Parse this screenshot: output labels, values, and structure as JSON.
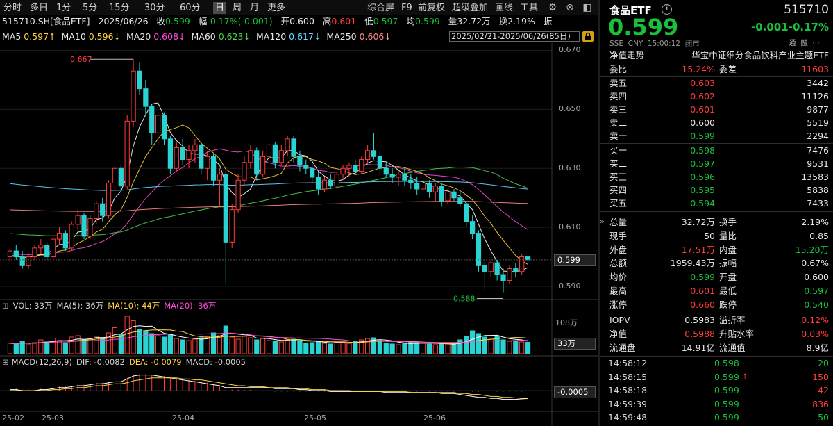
{
  "toolbar": {
    "periods": [
      "分时",
      "多日",
      "1分",
      "5分",
      "15分",
      "30分",
      "60分",
      "日",
      "周",
      "月",
      "更多"
    ],
    "active_period": "日",
    "tools": [
      "综合屏",
      "F9",
      "前复权",
      "超级叠加",
      "画线",
      "工具"
    ],
    "icons": [
      "gear-icon",
      "close-icon",
      "collapse-icon"
    ]
  },
  "info": {
    "code": "515710.SH[食品ETF]",
    "date": "2025/06/26",
    "close_label": "收",
    "close_val": "0.599",
    "chg_label": "幅",
    "chg_val": "-0.17%(-0.001)",
    "open_label": "开",
    "open_val": "0.600",
    "high_label": "高",
    "high_val": "0.601",
    "low_label": "低",
    "low_val": "0.597",
    "avg_label": "均",
    "avg_val": "0.599",
    "vol_label": "量",
    "vol_val": "32.72万",
    "turn_label": "换",
    "turn_val": "2.19%",
    "amp_label": "振"
  },
  "ma": {
    "items": [
      {
        "label": "MA5",
        "val": "0.597↑",
        "color": "#ffd23c"
      },
      {
        "label": "MA10",
        "val": "0.596↓",
        "color": "#ffd23c"
      },
      {
        "label": "MA20",
        "val": "0.608↓",
        "color": "#ff4ad8"
      },
      {
        "label": "MA60",
        "val": "0.623↓",
        "color": "#4fd34f"
      },
      {
        "label": "MA120",
        "val": "0.617↓",
        "color": "#6ad8ff"
      },
      {
        "label": "MA250",
        "val": "0.606↓",
        "color": "#ff8a8a"
      }
    ],
    "range": "2025/02/21-2025/06/26(85日)"
  },
  "price_axis": [
    "0.670",
    "0.650",
    "0.630",
    "0.610",
    "0.590"
  ],
  "current_price_tag": "0.599",
  "annotations": {
    "high": "0.667",
    "low": "0.588"
  },
  "vol_panel": {
    "header": "VOL: 33万 MA(5): 36万 MA(10): 44万 MA(20): 36万",
    "items": [
      {
        "text": "VOL: 33万",
        "color": "#d0d0d0"
      },
      {
        "text": "MA(5): 36万",
        "color": "#d0d0d0"
      },
      {
        "text": "MA(10): 44万",
        "color": "#ffd23c"
      },
      {
        "text": "MA(20): 36万",
        "color": "#ff4ad8"
      }
    ],
    "axis_top": "108万",
    "tag": "33万"
  },
  "macd_panel": {
    "items": [
      {
        "text": "MACD(12,26,9)",
        "color": "#d0d0d0"
      },
      {
        "text": "DIF: -0.0082",
        "color": "#d0d0d0"
      },
      {
        "text": "DEA: -0.0079",
        "color": "#ffd23c"
      },
      {
        "text": "MACD: -0.0005",
        "color": "#d0d0d0"
      }
    ],
    "tag": "-0.0005"
  },
  "x_axis": [
    "25-02",
    "25-03",
    "25-04",
    "25-05",
    "25-06"
  ],
  "right": {
    "name": "食品ETF",
    "info_icon": "info-icon",
    "code": "515710",
    "price": "0.599",
    "chg": "-0.001",
    "pct": "-0.17%",
    "sub": "SSE  CNY  15:00:12  闭市",
    "sub_icons": [
      "通",
      "融",
      "⋯"
    ],
    "nav_label": "净值走势",
    "fund_name": "华宝中证细分食品饮料产业主题ETF",
    "ratio": {
      "l1": "委比",
      "v1": "15.24%",
      "l2": "委差",
      "v2": "11603"
    },
    "asks": [
      {
        "label": "卖五",
        "price": "0.603",
        "vol": "3442",
        "c": "up"
      },
      {
        "label": "卖四",
        "price": "0.602",
        "vol": "11126",
        "c": "up"
      },
      {
        "label": "卖三",
        "price": "0.601",
        "vol": "9877",
        "c": "up"
      },
      {
        "label": "卖二",
        "price": "0.600",
        "vol": "5519",
        "c": "wh"
      },
      {
        "label": "卖一",
        "price": "0.599",
        "vol": "2294",
        "c": "dn"
      }
    ],
    "bids": [
      {
        "label": "买一",
        "price": "0.598",
        "vol": "7476",
        "c": "dn"
      },
      {
        "label": "买二",
        "price": "0.597",
        "vol": "9531",
        "c": "dn"
      },
      {
        "label": "买三",
        "price": "0.596",
        "vol": "13583",
        "c": "dn"
      },
      {
        "label": "买四",
        "price": "0.595",
        "vol": "5838",
        "c": "dn"
      },
      {
        "label": "买五",
        "price": "0.594",
        "vol": "7433",
        "c": "dn"
      }
    ],
    "stats": [
      {
        "l1": "总量",
        "v1": "32.72万",
        "c1": "wh",
        "l2": "换手",
        "v2": "2.19%",
        "c2": "wh"
      },
      {
        "l1": "现手",
        "v1": "50",
        "c1": "wh",
        "l2": "量比",
        "v2": "0.85",
        "c2": "wh"
      },
      {
        "l1": "外盘",
        "v1": "17.51万",
        "c1": "up",
        "l2": "内盘",
        "v2": "15.20万",
        "c2": "dn"
      },
      {
        "l1": "总额",
        "v1": "1959.43万",
        "c1": "wh",
        "l2": "振幅",
        "v2": "0.67%",
        "c2": "wh"
      },
      {
        "l1": "均价",
        "v1": "0.599",
        "c1": "dn",
        "l2": "开盘",
        "v2": "0.600",
        "c2": "wh"
      },
      {
        "l1": "最高",
        "v1": "0.601",
        "c1": "up",
        "l2": "最低",
        "v2": "0.597",
        "c2": "dn"
      },
      {
        "l1": "涨停",
        "v1": "0.660",
        "c1": "up",
        "l2": "跌停",
        "v2": "0.540",
        "c2": "dn"
      }
    ],
    "fund": [
      {
        "l1": "IOPV",
        "v1": "0.5983",
        "c1": "wh",
        "l2": "溢折率",
        "v2": "0.12%",
        "c2": "up"
      },
      {
        "l1": "净值",
        "v1": "0.5988",
        "c1": "up",
        "l2": "升贴水率",
        "v2": "0.03%",
        "c2": "up"
      },
      {
        "l1": "流通盘",
        "v1": "14.91亿",
        "c1": "wh",
        "l2": "流通值",
        "v2": "8.9亿",
        "c2": "wh"
      }
    ],
    "ticks": [
      {
        "time": "14:58:12",
        "price": "0.598",
        "arrow": "",
        "vol": "20",
        "pc": "dn",
        "vc": "dn"
      },
      {
        "time": "14:58:15",
        "price": "0.599",
        "arrow": "↑",
        "vol": "150",
        "pc": "dn",
        "vc": "up"
      },
      {
        "time": "14:58:18",
        "price": "0.599",
        "arrow": "",
        "vol": "42",
        "pc": "dn",
        "vc": "up"
      },
      {
        "time": "14:59:39",
        "price": "0.599",
        "arrow": "",
        "vol": "836",
        "pc": "dn",
        "vc": "up"
      },
      {
        "time": "14:59:48",
        "price": "0.599",
        "arrow": "",
        "vol": "50",
        "pc": "dn",
        "vc": "dn"
      }
    ]
  },
  "chart_data": {
    "type": "candlestick",
    "ylim": [
      0.586,
      0.672
    ],
    "ohlc": [
      [
        0.6,
        0.603,
        0.598,
        0.602
      ],
      [
        0.602,
        0.604,
        0.599,
        0.6
      ],
      [
        0.6,
        0.602,
        0.596,
        0.597
      ],
      [
        0.597,
        0.601,
        0.596,
        0.6
      ],
      [
        0.6,
        0.604,
        0.599,
        0.603
      ],
      [
        0.603,
        0.606,
        0.601,
        0.604
      ],
      [
        0.604,
        0.605,
        0.599,
        0.6
      ],
      [
        0.6,
        0.607,
        0.599,
        0.606
      ],
      [
        0.606,
        0.61,
        0.604,
        0.608
      ],
      [
        0.608,
        0.609,
        0.602,
        0.603
      ],
      [
        0.603,
        0.612,
        0.602,
        0.611
      ],
      [
        0.611,
        0.616,
        0.609,
        0.614
      ],
      [
        0.614,
        0.615,
        0.606,
        0.607
      ],
      [
        0.607,
        0.614,
        0.606,
        0.613
      ],
      [
        0.613,
        0.619,
        0.611,
        0.618
      ],
      [
        0.618,
        0.62,
        0.612,
        0.614
      ],
      [
        0.614,
        0.626,
        0.613,
        0.625
      ],
      [
        0.625,
        0.632,
        0.622,
        0.63
      ],
      [
        0.63,
        0.631,
        0.622,
        0.624
      ],
      [
        0.624,
        0.648,
        0.623,
        0.646
      ],
      [
        0.646,
        0.667,
        0.644,
        0.663
      ],
      [
        0.663,
        0.666,
        0.655,
        0.657
      ],
      [
        0.657,
        0.66,
        0.648,
        0.651
      ],
      [
        0.651,
        0.652,
        0.638,
        0.642
      ],
      [
        0.642,
        0.649,
        0.638,
        0.648
      ],
      [
        0.648,
        0.649,
        0.638,
        0.64
      ],
      [
        0.64,
        0.641,
        0.628,
        0.63
      ],
      [
        0.63,
        0.639,
        0.629,
        0.637
      ],
      [
        0.637,
        0.64,
        0.631,
        0.633
      ],
      [
        0.633,
        0.638,
        0.63,
        0.636
      ],
      [
        0.636,
        0.64,
        0.632,
        0.638
      ],
      [
        0.638,
        0.639,
        0.628,
        0.63
      ],
      [
        0.63,
        0.636,
        0.626,
        0.634
      ],
      [
        0.634,
        0.635,
        0.624,
        0.626
      ],
      [
        0.626,
        0.63,
        0.617,
        0.628
      ],
      [
        0.628,
        0.629,
        0.591,
        0.605
      ],
      [
        0.605,
        0.618,
        0.603,
        0.616
      ],
      [
        0.616,
        0.628,
        0.615,
        0.626
      ],
      [
        0.626,
        0.634,
        0.624,
        0.632
      ],
      [
        0.632,
        0.638,
        0.63,
        0.636
      ],
      [
        0.636,
        0.637,
        0.626,
        0.628
      ],
      [
        0.628,
        0.636,
        0.627,
        0.634
      ],
      [
        0.634,
        0.64,
        0.632,
        0.638
      ],
      [
        0.638,
        0.639,
        0.63,
        0.632
      ],
      [
        0.632,
        0.638,
        0.631,
        0.636
      ],
      [
        0.636,
        0.641,
        0.634,
        0.64
      ],
      [
        0.64,
        0.641,
        0.632,
        0.634
      ],
      [
        0.634,
        0.636,
        0.629,
        0.631
      ],
      [
        0.631,
        0.633,
        0.628,
        0.63
      ],
      [
        0.63,
        0.632,
        0.625,
        0.627
      ],
      [
        0.627,
        0.629,
        0.621,
        0.623
      ],
      [
        0.623,
        0.627,
        0.622,
        0.626
      ],
      [
        0.626,
        0.628,
        0.623,
        0.624
      ],
      [
        0.624,
        0.629,
        0.623,
        0.628
      ],
      [
        0.628,
        0.631,
        0.626,
        0.63
      ],
      [
        0.63,
        0.632,
        0.627,
        0.631
      ],
      [
        0.631,
        0.633,
        0.628,
        0.629
      ],
      [
        0.629,
        0.634,
        0.628,
        0.633
      ],
      [
        0.633,
        0.638,
        0.631,
        0.636
      ],
      [
        0.636,
        0.642,
        0.633,
        0.634
      ],
      [
        0.634,
        0.636,
        0.628,
        0.63
      ],
      [
        0.63,
        0.632,
        0.627,
        0.628
      ],
      [
        0.628,
        0.63,
        0.625,
        0.627
      ],
      [
        0.627,
        0.629,
        0.624,
        0.628
      ],
      [
        0.628,
        0.63,
        0.624,
        0.626
      ],
      [
        0.626,
        0.628,
        0.623,
        0.625
      ],
      [
        0.625,
        0.627,
        0.621,
        0.623
      ],
      [
        0.623,
        0.626,
        0.622,
        0.625
      ],
      [
        0.625,
        0.626,
        0.62,
        0.622
      ],
      [
        0.622,
        0.625,
        0.619,
        0.624
      ],
      [
        0.624,
        0.625,
        0.617,
        0.619
      ],
      [
        0.619,
        0.623,
        0.618,
        0.622
      ],
      [
        0.622,
        0.623,
        0.619,
        0.62
      ],
      [
        0.62,
        0.622,
        0.617,
        0.618
      ],
      [
        0.618,
        0.619,
        0.61,
        0.612
      ],
      [
        0.612,
        0.614,
        0.606,
        0.608
      ],
      [
        0.608,
        0.609,
        0.595,
        0.597
      ],
      [
        0.597,
        0.599,
        0.589,
        0.595
      ],
      [
        0.595,
        0.599,
        0.593,
        0.598
      ],
      [
        0.598,
        0.599,
        0.592,
        0.594
      ],
      [
        0.594,
        0.596,
        0.588,
        0.592
      ],
      [
        0.592,
        0.597,
        0.591,
        0.596
      ],
      [
        0.596,
        0.598,
        0.593,
        0.595
      ],
      [
        0.595,
        0.601,
        0.594,
        0.6
      ],
      [
        0.6,
        0.601,
        0.597,
        0.599
      ]
    ],
    "volume_wan": [
      30,
      28,
      35,
      26,
      32,
      40,
      34,
      45,
      38,
      30,
      48,
      52,
      40,
      44,
      50,
      46,
      60,
      75,
      55,
      108,
      95,
      70,
      66,
      58,
      52,
      48,
      56,
      44,
      40,
      38,
      42,
      46,
      50,
      60,
      52,
      80,
      48,
      42,
      50,
      46,
      40,
      44,
      38,
      36,
      34,
      40,
      42,
      38,
      30,
      32,
      36,
      30,
      28,
      34,
      32,
      30,
      36,
      40,
      44,
      46,
      38,
      30,
      28,
      26,
      30,
      34,
      32,
      30,
      28,
      26,
      30,
      28,
      26,
      40,
      50,
      66,
      58,
      48,
      42,
      52,
      40,
      36,
      38,
      34,
      33
    ],
    "macd": [
      0.002,
      0.002,
      0.001,
      0.001,
      0.001,
      0.002,
      0.002,
      0.003,
      0.004,
      0.004,
      0.005,
      0.006,
      0.006,
      0.007,
      0.008,
      0.008,
      0.009,
      0.01,
      0.01,
      0.013,
      0.016,
      0.017,
      0.017,
      0.016,
      0.016,
      0.015,
      0.013,
      0.013,
      0.012,
      0.011,
      0.01,
      0.009,
      0.008,
      0.006,
      0.005,
      0.002,
      0.001,
      0.001,
      0.001,
      0.001,
      0.0,
      0.0,
      0.0,
      -0.001,
      -0.001,
      -0.001,
      -0.001,
      -0.001,
      -0.001,
      -0.001,
      -0.001,
      -0.001,
      -0.001,
      -0.001,
      -0.001,
      -0.001,
      -0.001,
      -0.001,
      -0.001,
      -0.001,
      -0.001,
      -0.001,
      -0.001,
      -0.001,
      -0.001,
      -0.001,
      -0.001,
      -0.001,
      -0.001,
      -0.001,
      -0.001,
      -0.001,
      -0.001,
      -0.001,
      -0.001,
      -0.001,
      -0.001,
      -0.001,
      -0.001,
      -0.001,
      -0.001,
      -0.001,
      -0.001,
      -0.001,
      -0.0005
    ],
    "dif": [
      0.001,
      0.001,
      0.0,
      0.0,
      0.0,
      0.001,
      0.001,
      0.002,
      0.003,
      0.003,
      0.004,
      0.005,
      0.005,
      0.006,
      0.007,
      0.007,
      0.008,
      0.009,
      0.009,
      0.012,
      0.015,
      0.016,
      0.016,
      0.016,
      0.015,
      0.014,
      0.013,
      0.012,
      0.011,
      0.01,
      0.009,
      0.008,
      0.007,
      0.006,
      0.005,
      0.003,
      0.003,
      0.003,
      0.003,
      0.003,
      0.003,
      0.003,
      0.003,
      0.002,
      0.002,
      0.002,
      0.002,
      0.001,
      0.001,
      0.0,
      0.0,
      0.0,
      -0.001,
      -0.001,
      -0.001,
      -0.001,
      -0.001,
      -0.001,
      -0.001,
      -0.001,
      -0.001,
      -0.002,
      -0.002,
      -0.002,
      -0.002,
      -0.002,
      -0.002,
      -0.002,
      -0.002,
      -0.002,
      -0.003,
      -0.003,
      -0.003,
      -0.004,
      -0.005,
      -0.006,
      -0.007,
      -0.007,
      -0.008,
      -0.008,
      -0.009,
      -0.009,
      -0.009,
      -0.0085,
      -0.0082
    ],
    "dea": [
      0.0,
      0.0,
      0.0,
      0.0,
      0.0,
      0.0,
      0.0,
      0.001,
      0.001,
      0.002,
      0.002,
      0.003,
      0.003,
      0.004,
      0.005,
      0.005,
      0.006,
      0.007,
      0.007,
      0.008,
      0.01,
      0.011,
      0.012,
      0.013,
      0.013,
      0.013,
      0.013,
      0.013,
      0.012,
      0.012,
      0.011,
      0.011,
      0.01,
      0.009,
      0.008,
      0.007,
      0.006,
      0.005,
      0.005,
      0.004,
      0.004,
      0.004,
      0.003,
      0.003,
      0.003,
      0.003,
      0.002,
      0.002,
      0.002,
      0.001,
      0.001,
      0.001,
      0.0,
      0.0,
      0.0,
      0.0,
      -0.001,
      -0.001,
      -0.001,
      -0.001,
      -0.001,
      -0.001,
      -0.001,
      -0.001,
      -0.001,
      -0.002,
      -0.002,
      -0.002,
      -0.002,
      -0.002,
      -0.002,
      -0.002,
      -0.002,
      -0.003,
      -0.003,
      -0.004,
      -0.004,
      -0.005,
      -0.006,
      -0.006,
      -0.007,
      -0.007,
      -0.0075,
      -0.0078,
      -0.0079
    ]
  }
}
